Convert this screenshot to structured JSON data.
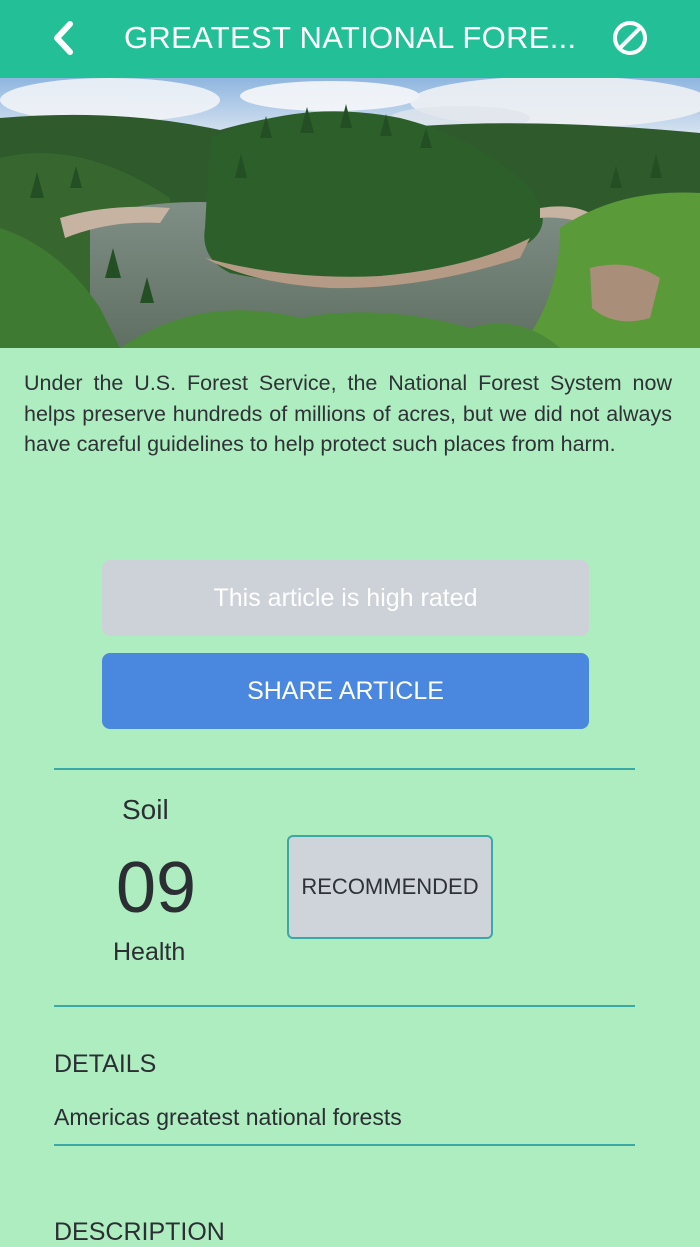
{
  "header": {
    "title": "GREATEST NATIONAL FORE...",
    "back_icon": "chevron-left-icon",
    "action_icon": "block-icon",
    "background_color": "#23bf97"
  },
  "hero": {
    "image": "forest-river-photo"
  },
  "article": {
    "intro": "Under the U.S. Forest Service, the National Forest System now helps preserve hundreds of millions of acres, but we did not always have careful guidelines to help protect such places from harm."
  },
  "buttons": {
    "rated_label": "This article is high rated",
    "share_label": "SHARE ARTICLE",
    "share_color": "#4a88df",
    "rated_color": "#cdd1d8"
  },
  "soil": {
    "label": "Soil",
    "value": "09",
    "sublabel": "Health",
    "recommended_label": "RECOMMENDED"
  },
  "details": {
    "heading": "DETAILS",
    "value": "Americas greatest national forests"
  },
  "description": {
    "heading": "DESCRIPTION"
  },
  "colors": {
    "page_background": "#aeedc0",
    "divider": "#3aa9a6"
  }
}
